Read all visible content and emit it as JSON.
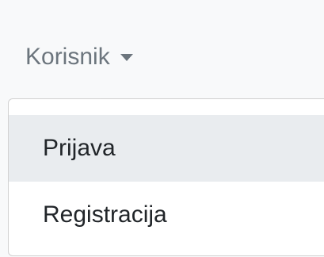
{
  "navbar": {
    "user_menu_label": "Korisnik",
    "caret_icon": "caret-down-icon"
  },
  "dropdown": {
    "items": [
      {
        "label": "Prijava",
        "highlighted": true
      },
      {
        "label": "Registracija",
        "highlighted": false
      }
    ]
  },
  "colors": {
    "navbar_background": "#f8f9fa",
    "toggle_text": "#6c757d",
    "menu_background": "#ffffff",
    "item_text": "#212529",
    "item_highlight": "#e9ecef"
  }
}
